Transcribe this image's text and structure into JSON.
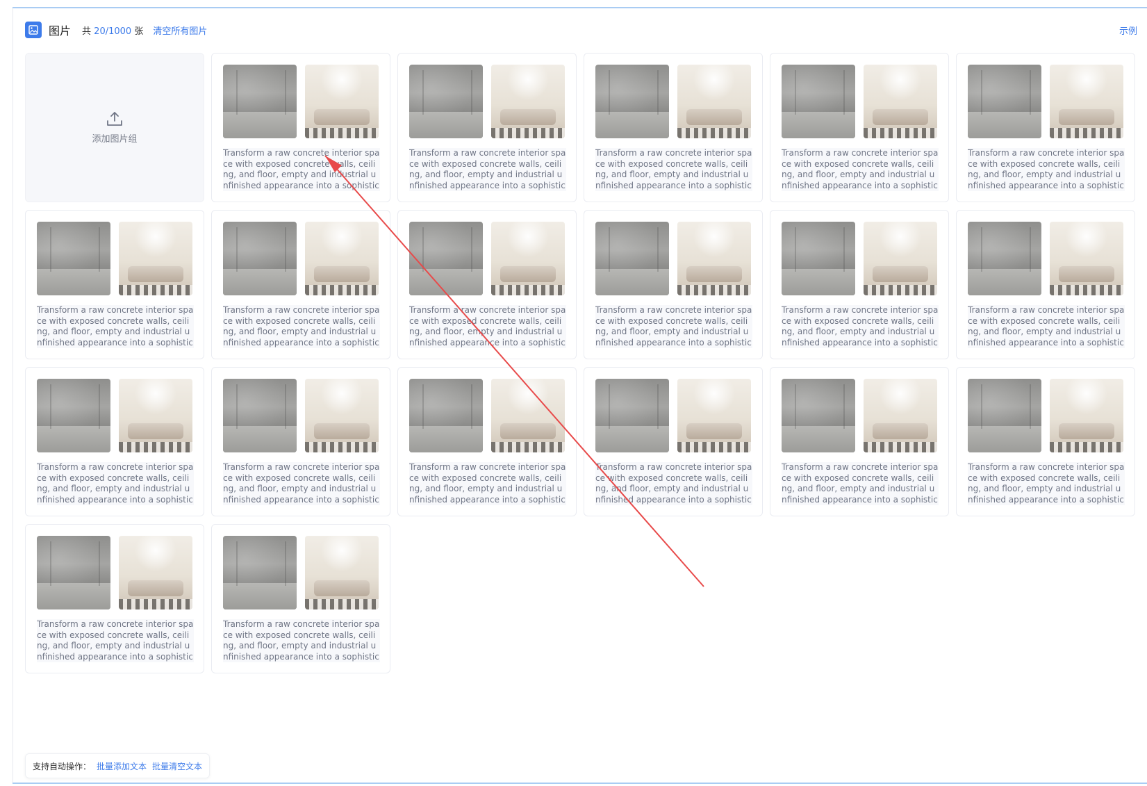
{
  "header": {
    "title": "图片",
    "count_prefix": "共",
    "count_value": "20/1000",
    "count_suffix": "张",
    "clear_all": "清空所有图片",
    "example": "示例"
  },
  "upload": {
    "label": "添加图片组"
  },
  "card_text": "Transform a raw concrete interior space with exposed concrete walls, ceiling, and floor, empty and industrial unfinished appearance into a sophisticated moder",
  "cards_count": 19,
  "footer": {
    "label": "支持自动操作：",
    "add_text": "批量添加文本",
    "clear_text": "批量清空文本"
  },
  "annotation": {
    "arrow_color": "#e84a4a"
  }
}
